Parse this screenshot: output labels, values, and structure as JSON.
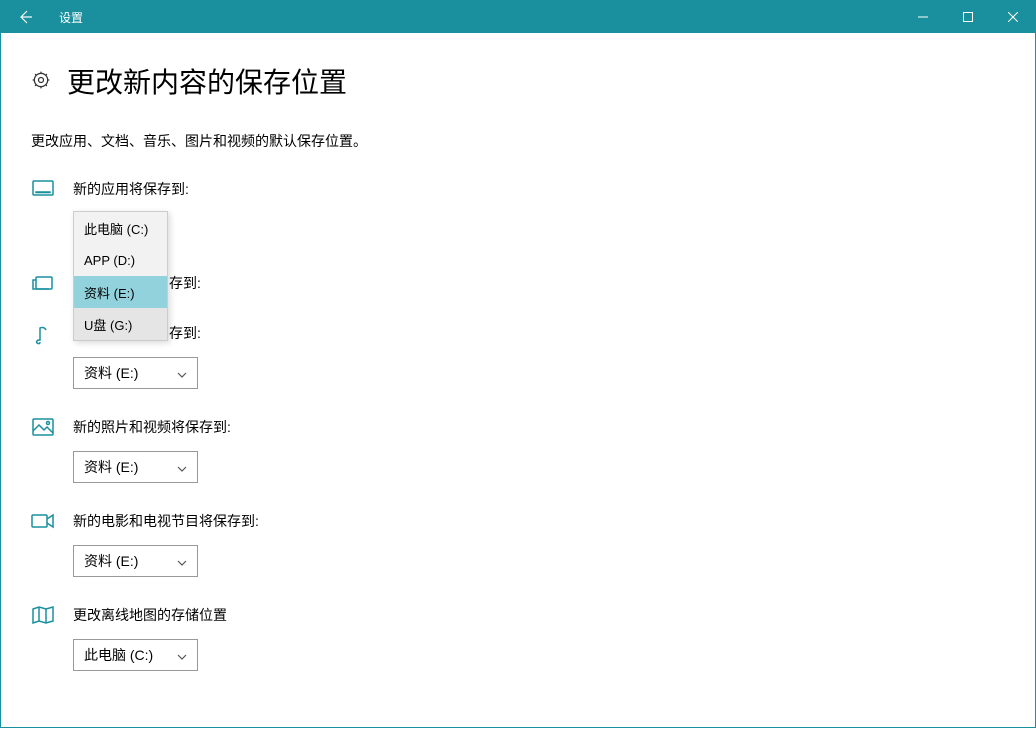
{
  "window": {
    "title": "设置"
  },
  "page": {
    "heading": "更改新内容的保存位置",
    "subheading": "更改应用、文档、音乐、图片和视频的默认保存位置。"
  },
  "settings": {
    "apps": {
      "label": "新的应用将保存到:",
      "value": "APP (D:)"
    },
    "documents": {
      "label_partial": "存到:"
    },
    "music": {
      "label_partial": "存到:",
      "value": "资料 (E:)"
    },
    "photos": {
      "label": "新的照片和视频将保存到:",
      "value": "资料 (E:)"
    },
    "movies": {
      "label": "新的电影和电视节目将保存到:",
      "value": "资料 (E:)"
    },
    "maps": {
      "label": "更改离线地图的存储位置",
      "value": "此电脑 (C:)"
    }
  },
  "dropdown_options": {
    "opt1": "此电脑 (C:)",
    "opt2": "APP (D:)",
    "opt3": "资料 (E:)",
    "opt4": "U盘 (G:)"
  }
}
